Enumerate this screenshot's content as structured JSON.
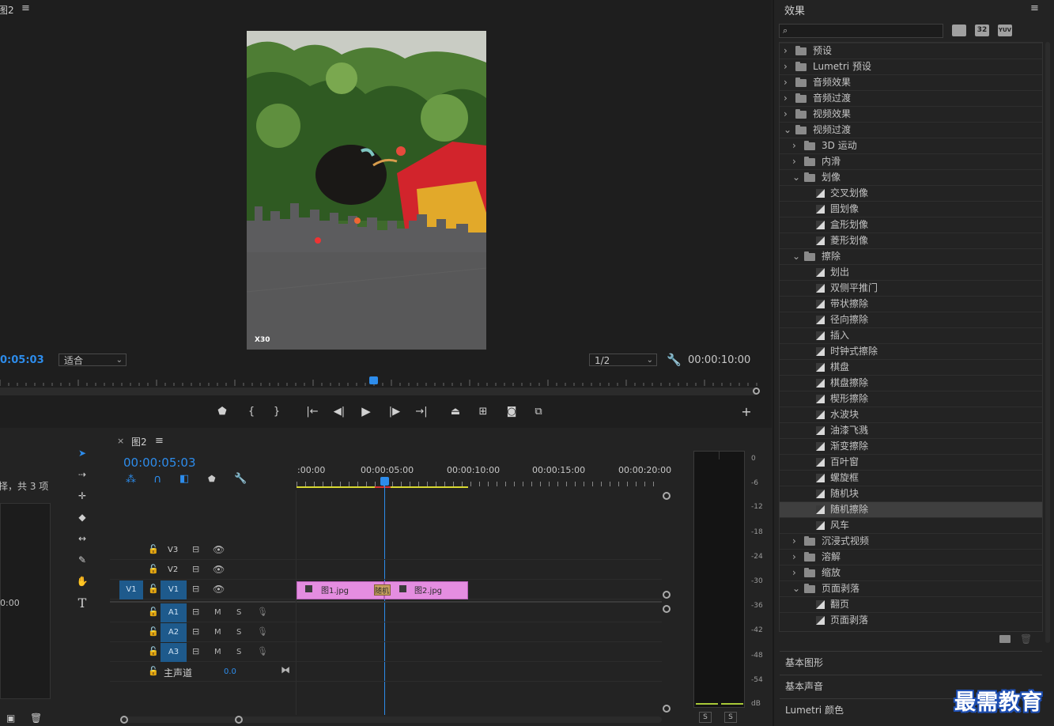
{
  "program_monitor": {
    "tab_title": "图2",
    "current_time": "0:05:03",
    "fit_option": "适合",
    "resolution": "1/2",
    "duration": "00:00:10:00",
    "camera_watermark": "X30"
  },
  "project_panel": {
    "status_text": "择，共 3 项",
    "time_text": "0:00"
  },
  "timeline": {
    "tab_title": "图2",
    "current_time": "00:00:05:03",
    "ruler_labels": [
      ":00:00",
      "00:00:05:00",
      "00:00:10:00",
      "00:00:15:00",
      "00:00:20:00"
    ],
    "tracks_video": [
      "V3",
      "V2",
      "V1"
    ],
    "source_patch": "V1",
    "tracks_audio": [
      "A1",
      "A2",
      "A3"
    ],
    "mute_label": "M",
    "solo_label": "S",
    "master": {
      "label": "主声道",
      "value": "0.0"
    },
    "clips": [
      {
        "label": "图1.jpg"
      },
      {
        "label": "图2.jpg"
      },
      {
        "label": "随机"
      }
    ]
  },
  "audio_meter": {
    "db_labels": [
      "0",
      "-6",
      "-12",
      "-18",
      "-24",
      "-30",
      "-36",
      "-42",
      "-48",
      "-54",
      "dB"
    ],
    "solo_buttons": [
      "S",
      "S"
    ]
  },
  "effects_panel": {
    "title": "效果",
    "search_placeholder": "",
    "badges": [
      "32",
      "YUV"
    ],
    "tree": [
      {
        "label": "预设",
        "kind": "folder-special",
        "level": 0,
        "expanded": false
      },
      {
        "label": "Lumetri 预设",
        "kind": "folder-special",
        "level": 0,
        "expanded": false
      },
      {
        "label": "音频效果",
        "kind": "folder",
        "level": 0,
        "expanded": false
      },
      {
        "label": "音频过渡",
        "kind": "folder",
        "level": 0,
        "expanded": false
      },
      {
        "label": "视频效果",
        "kind": "folder",
        "level": 0,
        "expanded": false
      },
      {
        "label": "视频过渡",
        "kind": "folder",
        "level": 0,
        "expanded": true
      },
      {
        "label": "3D 运动",
        "kind": "folder",
        "level": 1,
        "expanded": false
      },
      {
        "label": "内滑",
        "kind": "folder",
        "level": 1,
        "expanded": false
      },
      {
        "label": "划像",
        "kind": "folder",
        "level": 1,
        "expanded": true
      },
      {
        "label": "交叉划像",
        "kind": "effect",
        "level": 2
      },
      {
        "label": "圆划像",
        "kind": "effect",
        "level": 2
      },
      {
        "label": "盒形划像",
        "kind": "effect",
        "level": 2
      },
      {
        "label": "菱形划像",
        "kind": "effect",
        "level": 2
      },
      {
        "label": "擦除",
        "kind": "folder",
        "level": 1,
        "expanded": true
      },
      {
        "label": "划出",
        "kind": "effect",
        "level": 2
      },
      {
        "label": "双侧平推门",
        "kind": "effect",
        "level": 2
      },
      {
        "label": "带状擦除",
        "kind": "effect",
        "level": 2
      },
      {
        "label": "径向擦除",
        "kind": "effect",
        "level": 2
      },
      {
        "label": "插入",
        "kind": "effect",
        "level": 2
      },
      {
        "label": "时钟式擦除",
        "kind": "effect",
        "level": 2
      },
      {
        "label": "棋盘",
        "kind": "effect",
        "level": 2
      },
      {
        "label": "棋盘擦除",
        "kind": "effect",
        "level": 2
      },
      {
        "label": "楔形擦除",
        "kind": "effect",
        "level": 2
      },
      {
        "label": "水波块",
        "kind": "effect",
        "level": 2
      },
      {
        "label": "油漆飞溅",
        "kind": "effect",
        "level": 2
      },
      {
        "label": "渐变擦除",
        "kind": "effect",
        "level": 2
      },
      {
        "label": "百叶窗",
        "kind": "effect",
        "level": 2
      },
      {
        "label": "螺旋框",
        "kind": "effect",
        "level": 2
      },
      {
        "label": "随机块",
        "kind": "effect",
        "level": 2
      },
      {
        "label": "随机擦除",
        "kind": "effect",
        "level": 2,
        "selected": true
      },
      {
        "label": "风车",
        "kind": "effect",
        "level": 2
      },
      {
        "label": "沉浸式视频",
        "kind": "folder",
        "level": 1,
        "expanded": false
      },
      {
        "label": "溶解",
        "kind": "folder",
        "level": 1,
        "expanded": false
      },
      {
        "label": "缩放",
        "kind": "folder",
        "level": 1,
        "expanded": false
      },
      {
        "label": "页面剥落",
        "kind": "folder",
        "level": 1,
        "expanded": true
      },
      {
        "label": "翻页",
        "kind": "effect",
        "level": 2
      },
      {
        "label": "页面剥落",
        "kind": "effect",
        "level": 2
      }
    ],
    "sections": [
      "基本图形",
      "基本声音",
      "Lumetri 颜色"
    ]
  },
  "watermark": "最需教育",
  "colors": {
    "accent_blue": "#2d8ceb",
    "clip_pink": "#e48de0",
    "track_blue": "#1e5a8c",
    "panel_bg": "#232323"
  }
}
